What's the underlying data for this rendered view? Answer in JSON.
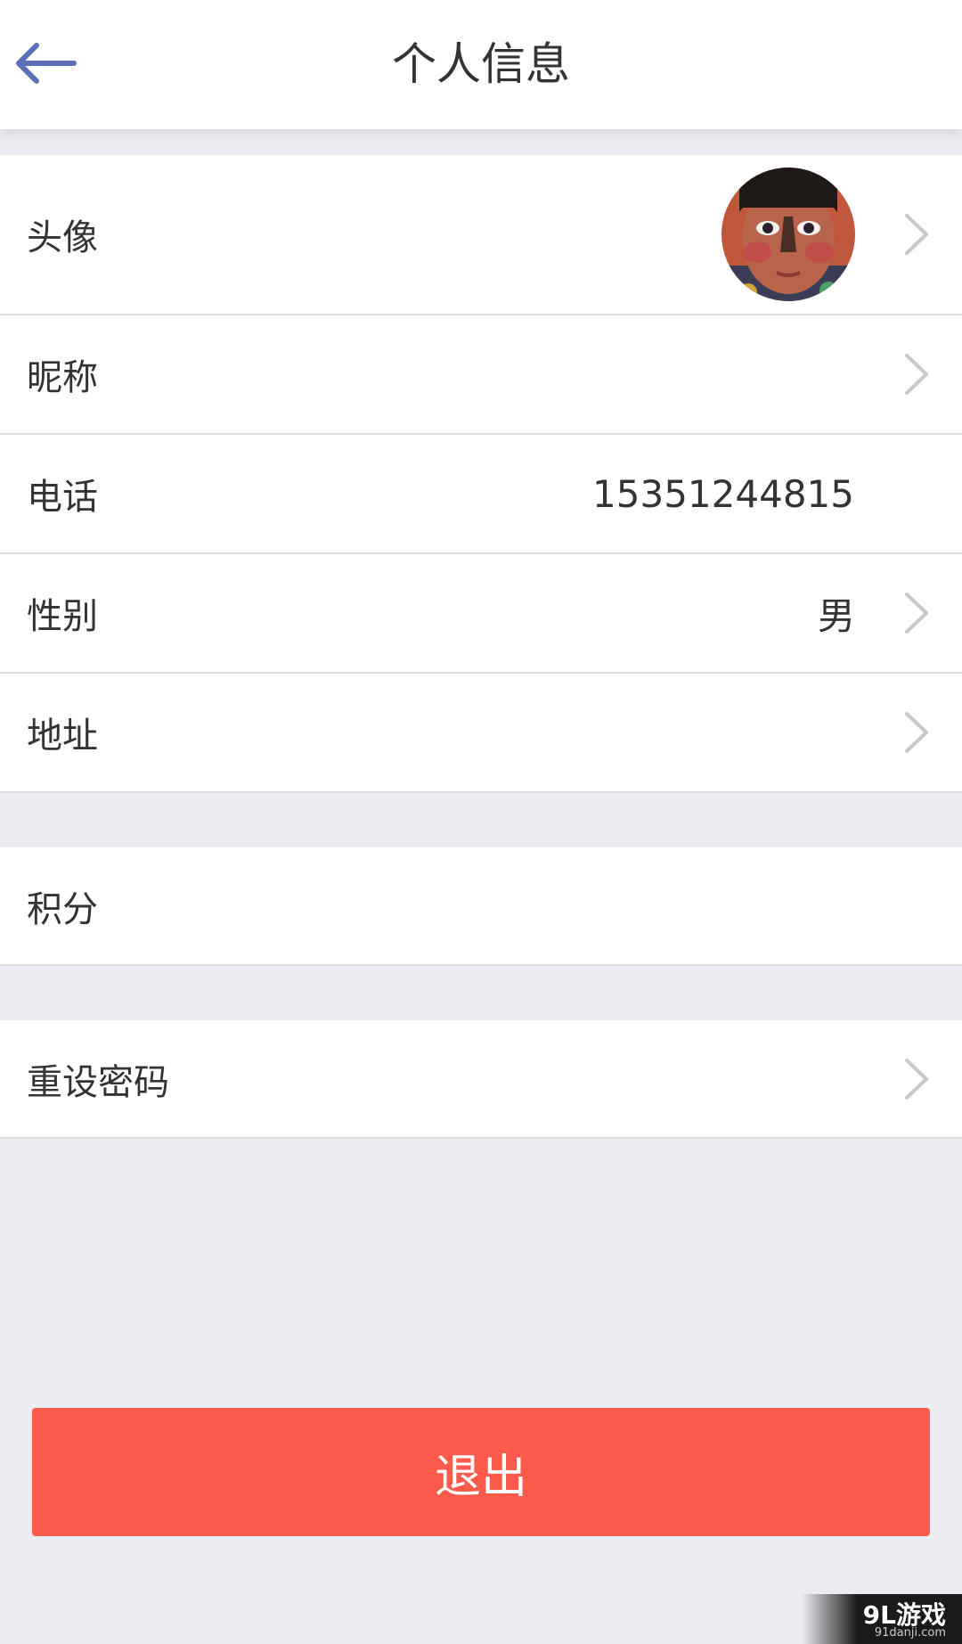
{
  "header": {
    "back_icon": "arrow-left-icon",
    "title": "个人信息"
  },
  "profile": {
    "avatar": {
      "label": "头像"
    },
    "nickname": {
      "label": "昵称",
      "value": ""
    },
    "phone": {
      "label": "电话",
      "value": "15351244815"
    },
    "gender": {
      "label": "性别",
      "value": "男"
    },
    "address": {
      "label": "地址",
      "value": ""
    }
  },
  "points": {
    "label": "积分"
  },
  "reset_password": {
    "label": "重设密码"
  },
  "logout": {
    "label": "退出"
  },
  "watermark": {
    "main": "9L游戏",
    "sub": "91danji.com"
  },
  "colors": {
    "accent": "#5b6fb8",
    "logout_bg": "#fc5a4a",
    "page_bg": "#ebebf1",
    "divider": "#dcdcde",
    "chevron": "#c8c8c8"
  }
}
